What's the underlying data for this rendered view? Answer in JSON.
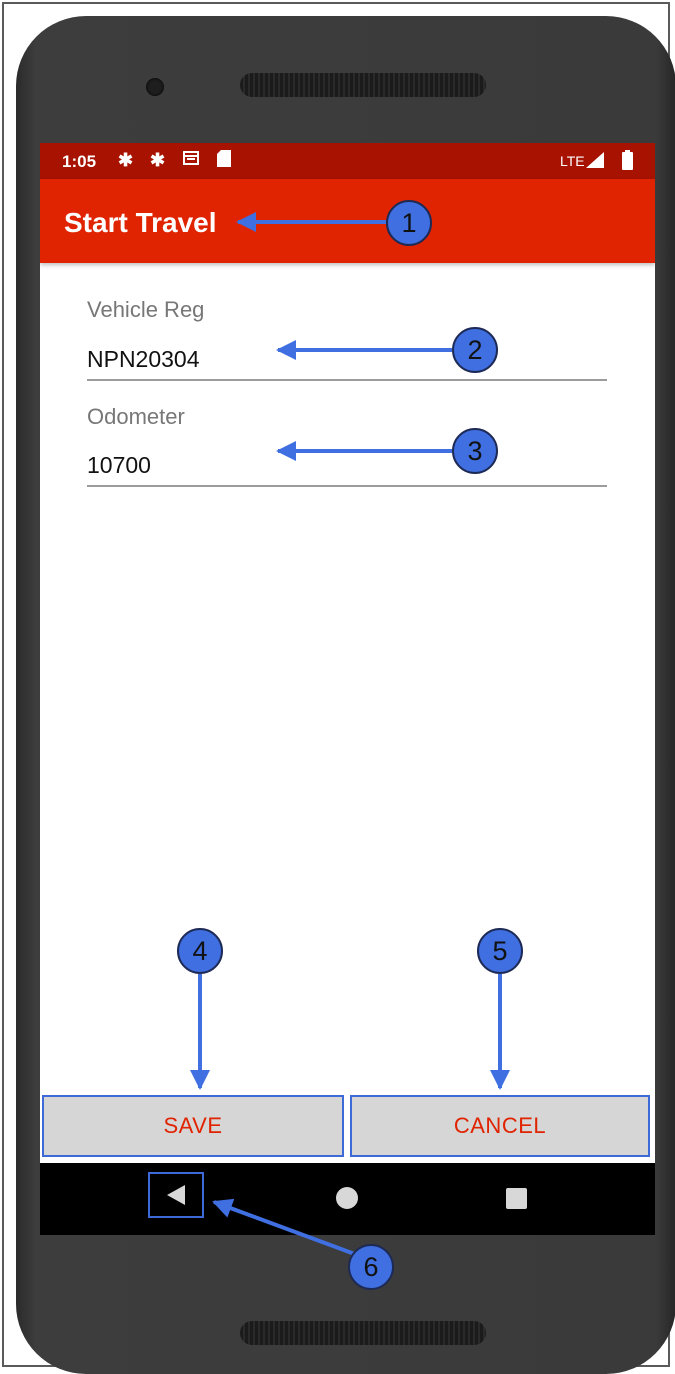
{
  "status_bar": {
    "time": "1:05",
    "network": "LTE",
    "icons": [
      "gear-icon",
      "gear-icon",
      "calendar-icon",
      "sd-card-icon",
      "signal-icon",
      "battery-icon"
    ]
  },
  "app_bar": {
    "title": "Start Travel"
  },
  "form": {
    "vehicle_reg": {
      "label": "Vehicle Reg",
      "value": "NPN20304"
    },
    "odometer": {
      "label": "Odometer",
      "value": "10700"
    }
  },
  "buttons": {
    "save": "SAVE",
    "cancel": "CANCEL"
  },
  "nav_bar": {
    "icons": [
      "back-icon",
      "home-icon",
      "recents-icon"
    ]
  },
  "annotations": [
    "1",
    "2",
    "3",
    "4",
    "5",
    "6"
  ],
  "colors": {
    "status_bar": "#a71300",
    "app_bar": "#e02300",
    "button_text": "#e02300",
    "button_bg": "#d6d6d6",
    "annotation": "#3f6fe0"
  }
}
